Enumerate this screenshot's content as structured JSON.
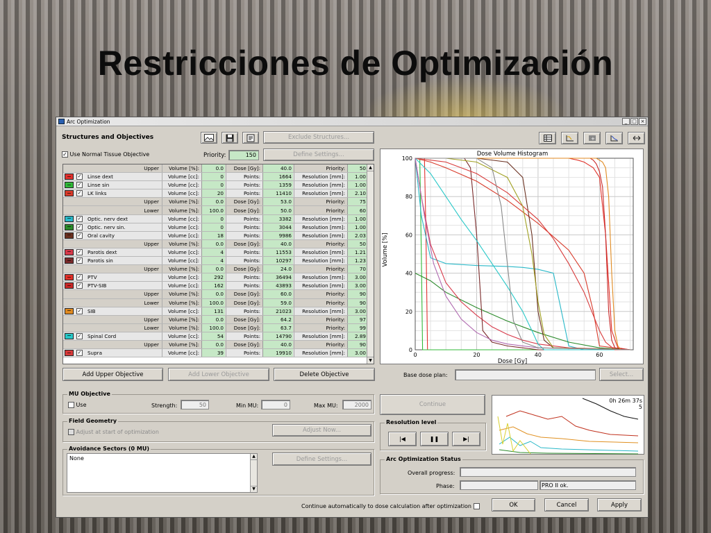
{
  "slide_title": "Restricciones de Optimización",
  "window": {
    "title": "Arc Optimization",
    "buttons": [
      "_",
      "□",
      "×"
    ]
  },
  "structures": {
    "heading": "Structures and Objectives",
    "exclude_label": "Exclude Structures...",
    "normal_tissue_label": "Use Normal Tissue Objective",
    "normal_tissue_checked": "✓",
    "priority_label": "Priority:",
    "priority_value": "150",
    "define_settings_label": "Define Settings..."
  },
  "table": {
    "rows": [
      {
        "kind": "sub",
        "name": "Upper",
        "c1": "Volume [%]:",
        "v1": "0.0",
        "c2": "Dose [Gy]:",
        "v2": "40.0",
        "c3": "Priority:",
        "v3": "50"
      },
      {
        "kind": "struct",
        "color": "#e0302c",
        "name": "Linse dext",
        "c1": "Volume [cc]:",
        "v1": "0",
        "c2": "Points:",
        "v2": "1664",
        "c3": "Resolution [mm]:",
        "v3": "1.00"
      },
      {
        "kind": "struct",
        "color": "#30b838",
        "name": "Linse sin",
        "c1": "Volume [cc]:",
        "v1": "0",
        "c2": "Points:",
        "v2": "1359",
        "c3": "Resolution [mm]:",
        "v3": "1.00"
      },
      {
        "kind": "struct",
        "color": "#d83a2a",
        "name": "LK links",
        "c1": "Volume [cc]:",
        "v1": "20",
        "c2": "Points:",
        "v2": "11410",
        "c3": "Resolution [mm]:",
        "v3": "2.10"
      },
      {
        "kind": "sub",
        "name": "Upper",
        "c1": "Volume [%]:",
        "v1": "0.0",
        "c2": "Dose [Gy]:",
        "v2": "53.0",
        "c3": "Priority:",
        "v3": "75"
      },
      {
        "kind": "sub",
        "name": "Lower",
        "c1": "Volume [%]:",
        "v1": "100.0",
        "c2": "Dose [Gy]:",
        "v2": "50.0",
        "c3": "Priority:",
        "v3": "60"
      },
      {
        "kind": "struct",
        "color": "#28b8c8",
        "name": "Optic. nerv dext",
        "c1": "Volume [cc]:",
        "v1": "0",
        "c2": "Points:",
        "v2": "3382",
        "c3": "Resolution [mm]:",
        "v3": "1.00"
      },
      {
        "kind": "struct",
        "color": "#2a8a2a",
        "name": "Optic. nerv sin.",
        "c1": "Volume [cc]:",
        "v1": "0",
        "c2": "Points:",
        "v2": "3044",
        "c3": "Resolution [mm]:",
        "v3": "1.00"
      },
      {
        "kind": "struct",
        "color": "#6a3020",
        "name": "Oral cavity",
        "c1": "Volume [cc]:",
        "v1": "18",
        "c2": "Points:",
        "v2": "9986",
        "c3": "Resolution [mm]:",
        "v3": "2.03"
      },
      {
        "kind": "sub",
        "name": "Upper",
        "c1": "Volume [%]:",
        "v1": "0.0",
        "c2": "Dose [Gy]:",
        "v2": "40.0",
        "c3": "Priority:",
        "v3": "50"
      },
      {
        "kind": "struct",
        "color": "#d83a4a",
        "name": "Parotis dext",
        "c1": "Volume [cc]:",
        "v1": "4",
        "c2": "Points:",
        "v2": "11553",
        "c3": "Resolution [mm]:",
        "v3": "1.21"
      },
      {
        "kind": "struct",
        "color": "#7a2a2a",
        "name": "Parotis sin",
        "c1": "Volume [cc]:",
        "v1": "4",
        "c2": "Points:",
        "v2": "10297",
        "c3": "Resolution [mm]:",
        "v3": "1.23"
      },
      {
        "kind": "sub",
        "name": "Upper",
        "c1": "Volume [%]:",
        "v1": "0.0",
        "c2": "Dose [Gy]:",
        "v2": "24.0",
        "c3": "Priority:",
        "v3": "70"
      },
      {
        "kind": "struct",
        "color": "#e03028",
        "name": "PTV",
        "c1": "Volume [cc]:",
        "v1": "292",
        "c2": "Points:",
        "v2": "36494",
        "c3": "Resolution [mm]:",
        "v3": "3.00"
      },
      {
        "kind": "struct",
        "color": "#c82828",
        "name": "PTV-SIB",
        "c1": "Volume [cc]:",
        "v1": "162",
        "c2": "Points:",
        "v2": "43893",
        "c3": "Resolution [mm]:",
        "v3": "3.00"
      },
      {
        "kind": "sub",
        "name": "Upper",
        "c1": "Volume [%]:",
        "v1": "0.0",
        "c2": "Dose [Gy]:",
        "v2": "60.0",
        "c3": "Priority:",
        "v3": "90"
      },
      {
        "kind": "sub",
        "name": "Lower",
        "c1": "Volume [%]:",
        "v1": "100.0",
        "c2": "Dose [Gy]:",
        "v2": "59.0",
        "c3": "Priority:",
        "v3": "90"
      },
      {
        "kind": "struct",
        "color": "#e08a20",
        "name": "SIB",
        "c1": "Volume [cc]:",
        "v1": "131",
        "c2": "Points:",
        "v2": "21023",
        "c3": "Resolution [mm]:",
        "v3": "3.00"
      },
      {
        "kind": "sub",
        "name": "Upper",
        "c1": "Volume [%]:",
        "v1": "0.0",
        "c2": "Dose [Gy]:",
        "v2": "64.2",
        "c3": "Priority:",
        "v3": "97"
      },
      {
        "kind": "sub",
        "name": "Lower",
        "c1": "Volume [%]:",
        "v1": "100.0",
        "c2": "Dose [Gy]:",
        "v2": "63.7",
        "c3": "Priority:",
        "v3": "99"
      },
      {
        "kind": "struct",
        "color": "#28c8c8",
        "name": "Spinal Cord",
        "c1": "Volume [cc]:",
        "v1": "54",
        "c2": "Points:",
        "v2": "14790",
        "c3": "Resolution [mm]:",
        "v3": "2.89"
      },
      {
        "kind": "sub",
        "name": "Upper",
        "c1": "Volume [%]:",
        "v1": "0.0",
        "c2": "Dose [Gy]:",
        "v2": "40.0",
        "c3": "Priority:",
        "v3": "90"
      },
      {
        "kind": "struct",
        "color": "#d83a3a",
        "name": "Supra",
        "c1": "Volume [cc]:",
        "v1": "39",
        "c2": "Points:",
        "v2": "19910",
        "c3": "Resolution [mm]:",
        "v3": "3.00"
      }
    ]
  },
  "objective_buttons": {
    "add_upper": "Add Upper Objective",
    "add_lower": "Add Lower Objective",
    "delete": "Delete Objective"
  },
  "dvh": {
    "title": "Dose Volume Histogram",
    "xlabel": "Dose [Gy]",
    "ylabel": "Volume [%]",
    "xticks": [
      "0",
      "20",
      "40",
      "60"
    ],
    "yticks": [
      "0",
      "20",
      "40",
      "60",
      "80",
      "100"
    ]
  },
  "chart_data": {
    "type": "line",
    "title": "Dose Volume Histogram",
    "xlabel": "Dose [Gy]",
    "ylabel": "Volume [%]",
    "xlim": [
      0,
      71
    ],
    "ylim": [
      0,
      100
    ],
    "grid": true,
    "series": [
      {
        "color": "#e0302c",
        "x": [
          0,
          3,
          3.5,
          4,
          70
        ],
        "y": [
          100,
          100,
          60,
          0,
          0
        ]
      },
      {
        "color": "#30b838",
        "x": [
          0,
          1.5,
          2,
          2.4,
          70
        ],
        "y": [
          100,
          100,
          50,
          0,
          0
        ]
      },
      {
        "color": "#d83a2a",
        "x": [
          0,
          5,
          10,
          20,
          30,
          40,
          50,
          55,
          58,
          60,
          70
        ],
        "y": [
          100,
          98,
          95,
          88,
          78,
          66,
          52,
          40,
          20,
          2,
          0
        ]
      },
      {
        "color": "#28b8c8",
        "x": [
          0,
          2,
          5,
          10,
          20,
          30,
          35,
          40,
          45,
          50,
          55,
          70
        ],
        "y": [
          100,
          70,
          48,
          45,
          44,
          43.5,
          43,
          42,
          40,
          2,
          0,
          0
        ]
      },
      {
        "color": "#2a8a2a",
        "x": [
          0,
          5,
          10,
          20,
          30,
          40,
          50,
          60,
          70
        ],
        "y": [
          40,
          36,
          30,
          22,
          15,
          9,
          4,
          1,
          0
        ]
      },
      {
        "color": "#6a3020",
        "x": [
          0,
          20,
          30,
          35,
          38,
          40,
          42,
          45,
          70
        ],
        "y": [
          100,
          100,
          98,
          90,
          60,
          20,
          5,
          1,
          0
        ]
      },
      {
        "color": "#d83a4a",
        "x": [
          0,
          2,
          5,
          10,
          15,
          20,
          25,
          30,
          35,
          40,
          50,
          70
        ],
        "y": [
          100,
          80,
          55,
          35,
          25,
          18,
          12,
          8,
          5,
          3,
          1,
          0
        ]
      },
      {
        "color": "#7a2a2a",
        "x": [
          0,
          16,
          18,
          20,
          22,
          25,
          30,
          35,
          40,
          70
        ],
        "y": [
          100,
          100,
          95,
          60,
          10,
          4,
          2,
          1,
          0,
          0
        ]
      },
      {
        "color": "#e03028",
        "x": [
          0,
          50,
          53,
          55,
          56,
          58,
          60,
          62,
          64,
          66,
          70
        ],
        "y": [
          100,
          100,
          99,
          98,
          97,
          95,
          90,
          60,
          10,
          1,
          0
        ]
      },
      {
        "color": "#c82828",
        "x": [
          0,
          57,
          58,
          59,
          60,
          61,
          62,
          63,
          64,
          65,
          70
        ],
        "y": [
          100,
          100,
          99,
          97,
          93,
          85,
          60,
          20,
          5,
          1,
          0
        ]
      },
      {
        "color": "#e08a20",
        "x": [
          0,
          59,
          60,
          61,
          62,
          63,
          64,
          65,
          66,
          67,
          70
        ],
        "y": [
          100,
          100,
          99,
          98,
          95,
          80,
          40,
          10,
          2,
          0,
          0
        ]
      },
      {
        "color": "#28c8c8",
        "x": [
          0,
          5,
          10,
          15,
          20,
          25,
          30,
          35,
          38,
          40,
          42,
          70
        ],
        "y": [
          100,
          92,
          80,
          68,
          57,
          45,
          33,
          20,
          10,
          3,
          0,
          0
        ]
      },
      {
        "color": "#d83a3a",
        "x": [
          0,
          10,
          20,
          30,
          40,
          45,
          50,
          55,
          60,
          62,
          65,
          70
        ],
        "y": [
          100,
          98,
          92,
          82,
          68,
          58,
          45,
          30,
          10,
          4,
          0,
          0
        ]
      },
      {
        "color": "#a0a020",
        "x": [
          0,
          10,
          20,
          30,
          35,
          38,
          40,
          42,
          45,
          70
        ],
        "y": [
          100,
          100,
          98,
          90,
          75,
          50,
          25,
          8,
          1,
          0
        ]
      },
      {
        "color": "#b06ab0",
        "x": [
          0,
          3,
          6,
          10,
          15,
          20,
          25,
          30,
          40,
          70
        ],
        "y": [
          100,
          70,
          45,
          28,
          16,
          9,
          5,
          3,
          1,
          0
        ]
      },
      {
        "color": "#888888",
        "x": [
          0,
          20,
          25,
          28,
          30,
          32,
          35,
          40,
          70
        ],
        "y": [
          100,
          100,
          95,
          75,
          45,
          15,
          4,
          1,
          0
        ]
      }
    ]
  },
  "base_dose": {
    "label": "Base dose plan:",
    "select_label": "Select..."
  },
  "mu_objective": {
    "title": "MU Objective",
    "use_label": "Use",
    "strength_label": "Strength:",
    "strength_value": "50",
    "min_mu_label": "Min MU:",
    "min_mu_value": "0",
    "max_mu_label": "Max MU:",
    "max_mu_value": "2000"
  },
  "continue_label": "Continue",
  "field_geometry": {
    "title": "Field Geometry",
    "adjust_label": "Adjust at start of optimization",
    "adjust_now_label": "Adjust Now..."
  },
  "avoidance": {
    "title": "Avoidance Sectors (0 MU)",
    "value": "None",
    "define_label": "Define Settings..."
  },
  "resolution": {
    "title": "Resolution level"
  },
  "mini_chart": {
    "time": "0h 26m 37s",
    "level": "5"
  },
  "status": {
    "title": "Arc Optimization Status",
    "overall_label": "Overall progress:",
    "phase_label": "Phase:",
    "phase_value": "PRO II ok."
  },
  "footer": {
    "continue_auto_label": "Continue automatically to dose calculation after optimization",
    "ok": "OK",
    "cancel": "Cancel",
    "apply": "Apply"
  }
}
